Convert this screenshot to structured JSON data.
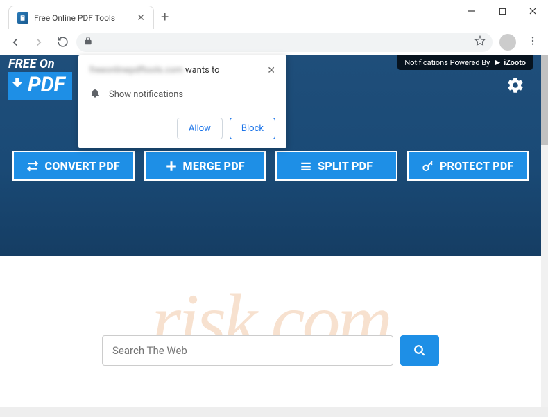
{
  "window": {
    "tab_title": "Free Online PDF Tools"
  },
  "permission": {
    "origin_blurred": "freeonlinepdftools.com",
    "wants_to": " wants to",
    "row_label": "Show notifications",
    "allow": "Allow",
    "block": "Block"
  },
  "header": {
    "logo_top": "FREE On",
    "logo_main": "PDF",
    "notif_powered": "Notifications Powered By",
    "notif_brand": "iZooto"
  },
  "actions": {
    "convert": "CONVERT PDF",
    "merge": "MERGE PDF",
    "split": "SPLIT PDF",
    "protect": "PROTECT PDF"
  },
  "search": {
    "placeholder": "Search The Web"
  },
  "watermark": "risk.com"
}
